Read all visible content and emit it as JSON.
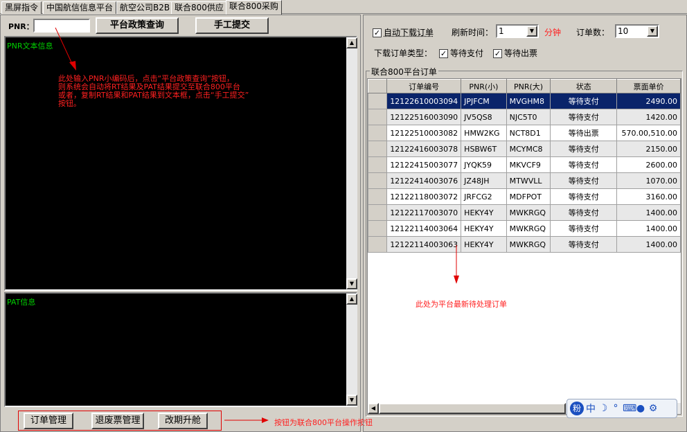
{
  "tabs": [
    "黑屏指令",
    "中国航信信息平台",
    "航空公司B2B",
    "联合800供应",
    "联合800采购"
  ],
  "left": {
    "pnr_label": "PNR：",
    "pnr_value": "",
    "query_button": "平台政策查询",
    "submit_button": "手工提交",
    "pnr_box_label": "PNR文本信息",
    "annotation_lines": [
      "此处输入PNR小编码后，点击“平台政策查询”按钮，",
      "则系统会自动将RT结果及PAT结果提交至联合800平台",
      "或者，复制RT结果和PAT结果到文本框，点击“手工提交”",
      "按钮。"
    ],
    "pat_box_label": "PAT信息",
    "bottom_buttons": [
      "订单管理",
      "退废票管理",
      "改期升舱"
    ],
    "bottom_annotation": "按钮为联合800平台操作按钮"
  },
  "right": {
    "auto_download_label": "自动下载订单",
    "auto_download_checked": true,
    "refresh_label": "刷新时间：",
    "refresh_value": "1",
    "refresh_unit": "分钟",
    "count_label": "订单数：",
    "count_value": "10",
    "type_label": "下载订单类型：",
    "type_wait_pay": "等待支付",
    "type_wait_issue": "等待出票",
    "group_title": "联合800平台订单",
    "columns": [
      "订单编号",
      "PNR(小)",
      "PNR(大)",
      "状态",
      "票面单价"
    ],
    "orders": [
      [
        "12122610003094",
        "JPJFCM",
        "MVGHM8",
        "等待支付",
        "2490.00"
      ],
      [
        "12122516003090",
        "JV5QS8",
        "NJC5T0",
        "等待支付",
        "1420.00"
      ],
      [
        "12122510003082",
        "HMW2KG",
        "NCT8D1",
        "等待出票",
        "570.00,510.00"
      ],
      [
        "12122416003078",
        "HSBW6T",
        "MCYMC8",
        "等待支付",
        "2150.00"
      ],
      [
        "12122415003077",
        "JYQK59",
        "MKVCF9",
        "等待支付",
        "2600.00"
      ],
      [
        "12122414003076",
        "JZ48JH",
        "MTWVLL",
        "等待支付",
        "1070.00"
      ],
      [
        "12122118003072",
        "JRFCG2",
        "MDFPOT",
        "等待支付",
        "3160.00"
      ],
      [
        "12122117003070",
        "HEKY4Y",
        "MWKRGQ",
        "等待支付",
        "1400.00"
      ],
      [
        "12122114003064",
        "HEKY4Y",
        "MWKRGQ",
        "等待支付",
        "1400.00"
      ],
      [
        "12122114003063",
        "HEKY4Y",
        "MWKRGQ",
        "等待支付",
        "1400.00"
      ]
    ],
    "table_annotation": "此处为平台最新待处理订单"
  },
  "ime": {
    "brand": "粉",
    "lang": "中"
  },
  "colors": {
    "annotation": "#ff2020",
    "console_text": "#00d000",
    "selection": "#0a246a"
  }
}
